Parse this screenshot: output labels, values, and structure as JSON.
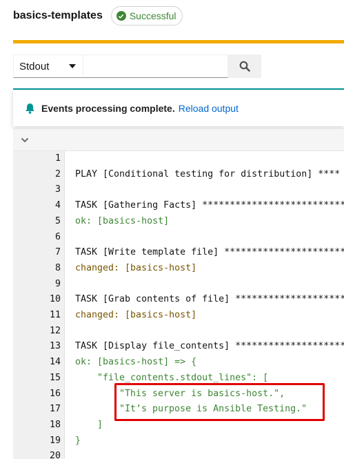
{
  "header": {
    "job_title": "basics-templates",
    "status": "Successful"
  },
  "toolbar": {
    "select_value": "Stdout",
    "search_value": ""
  },
  "alert": {
    "title": "Events processing complete.",
    "link": "Reload output"
  },
  "output": {
    "lines": [
      {
        "n": "1",
        "text": "",
        "kind": "plain",
        "indent": 0
      },
      {
        "n": "2",
        "text": "PLAY [Conditional testing for distribution] ****",
        "kind": "plain",
        "indent": 0
      },
      {
        "n": "3",
        "text": "",
        "kind": "plain",
        "indent": 0
      },
      {
        "n": "4",
        "text": "TASK [Gathering Facts] **************************",
        "kind": "plain",
        "indent": 0
      },
      {
        "n": "5",
        "text": "ok: [basics-host]",
        "kind": "ok",
        "indent": 0
      },
      {
        "n": "6",
        "text": "",
        "kind": "plain",
        "indent": 0
      },
      {
        "n": "7",
        "text": "TASK [Write template file] **********************",
        "kind": "plain",
        "indent": 0
      },
      {
        "n": "8",
        "text": "changed: [basics-host]",
        "kind": "changed",
        "indent": 0
      },
      {
        "n": "9",
        "text": "",
        "kind": "plain",
        "indent": 0
      },
      {
        "n": "10",
        "text": "TASK [Grab contents of file] ********************",
        "kind": "plain",
        "indent": 0
      },
      {
        "n": "11",
        "text": "changed: [basics-host]",
        "kind": "changed",
        "indent": 0
      },
      {
        "n": "12",
        "text": "",
        "kind": "plain",
        "indent": 0
      },
      {
        "n": "13",
        "text": "TASK [Display file_contents] ********************",
        "kind": "plain",
        "indent": 0
      },
      {
        "n": "14",
        "text": "ok: [basics-host] => {",
        "kind": "ok",
        "indent": 0
      },
      {
        "n": "15",
        "text": "\"file_contents.stdout_lines\": [",
        "kind": "ok",
        "indent": 1
      },
      {
        "n": "16",
        "text": "\"This server is basics-host.\",",
        "kind": "ok",
        "indent": 2
      },
      {
        "n": "17",
        "text": "\"It’s purpose is Ansible Testing.\"",
        "kind": "ok",
        "indent": 2
      },
      {
        "n": "18",
        "text": "]",
        "kind": "ok",
        "indent": 1
      },
      {
        "n": "19",
        "text": "}",
        "kind": "ok",
        "indent": 0
      },
      {
        "n": "20",
        "text": "",
        "kind": "plain",
        "indent": 0
      }
    ]
  },
  "colors": {
    "accent": "#f0ab00",
    "success": "#3e8635",
    "link": "#0066cc",
    "teal": "#009596",
    "annotation": "#e00000"
  }
}
